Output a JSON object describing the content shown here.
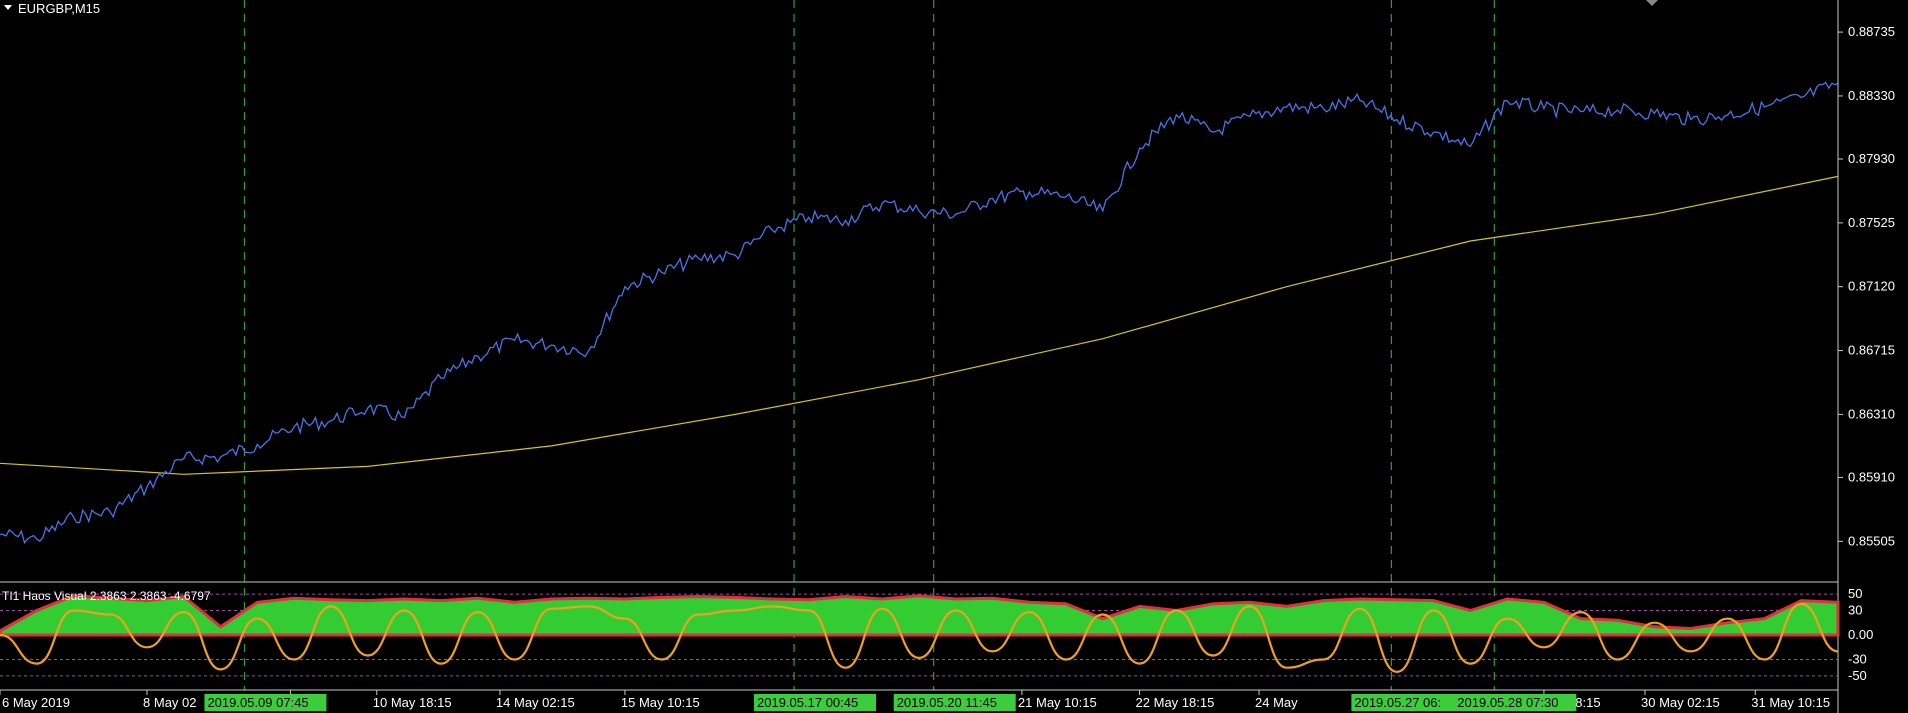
{
  "window": {
    "title": "EURGBP,M15"
  },
  "indicator": {
    "name": "TI1 Haos Visual 2.3863 2.3863 -4.6797",
    "levels": [
      "50",
      "30",
      "0.00",
      "-30",
      "-50"
    ]
  },
  "chart_data": {
    "type": "line",
    "symbol": "EURGBP",
    "timeframe": "M15",
    "price_axis": {
      "ticks": [
        "0.88735",
        "0.88330",
        "0.87930",
        "0.87525",
        "0.87120",
        "0.86715",
        "0.86310",
        "0.85910",
        "0.85505"
      ],
      "ylim": [
        0.8545,
        0.8878
      ]
    },
    "time_axis": {
      "ticks": [
        "6 May 2019",
        "8 May 02",
        "0:15",
        "10 May 18:15",
        "14 May 02:15",
        "15 May 10:15",
        "21 May 10:15",
        "22 May 18:15",
        "24 May",
        "May 18:15",
        "30 May 02:15",
        "31 May 10:15"
      ],
      "highlighted": [
        "2019.05.09 07:45",
        "2019.05.17 00:45",
        "2019.05.20 11:45",
        "2019.05.27 06:",
        "2019.05.28 07:30"
      ]
    },
    "series": [
      {
        "role": "price",
        "color": "#4a73e8",
        "x": [
          0,
          2,
          4,
          6,
          8,
          10,
          12,
          14,
          16,
          18,
          20,
          22,
          24,
          26,
          28,
          30,
          32,
          34,
          36,
          38,
          40,
          42,
          44,
          46,
          48,
          50,
          52,
          54,
          56,
          58,
          60,
          62,
          64,
          66,
          68,
          70,
          72,
          74,
          76,
          78,
          80,
          82,
          84,
          86,
          88,
          90,
          92,
          94,
          96,
          98,
          100
        ],
        "y": [
          0.8555,
          0.8552,
          0.8566,
          0.8569,
          0.8585,
          0.8603,
          0.8604,
          0.8612,
          0.8623,
          0.8627,
          0.8635,
          0.8629,
          0.8654,
          0.8668,
          0.8678,
          0.8675,
          0.8671,
          0.8712,
          0.8721,
          0.873,
          0.8732,
          0.8748,
          0.8756,
          0.8754,
          0.8765,
          0.876,
          0.8758,
          0.8768,
          0.8772,
          0.8769,
          0.876,
          0.88,
          0.8821,
          0.881,
          0.882,
          0.8826,
          0.8825,
          0.883,
          0.8818,
          0.881,
          0.8801,
          0.883,
          0.8825,
          0.8823,
          0.8824,
          0.8822,
          0.8818,
          0.8821,
          0.8826,
          0.8832,
          0.8841
        ]
      },
      {
        "role": "moving_average",
        "color": "#d4c42a",
        "x": [
          0,
          10,
          20,
          30,
          40,
          50,
          60,
          70,
          80,
          90,
          100
        ],
        "y": [
          0.86,
          0.8593,
          0.8598,
          0.8611,
          0.8631,
          0.8653,
          0.8679,
          0.8712,
          0.8741,
          0.8758,
          0.8782
        ]
      }
    ],
    "vlines_x": [
      13.3,
      43.2,
      50.8,
      75.7,
      81.3
    ],
    "indicator_data": {
      "ylim": [
        -55,
        55
      ],
      "x": [
        0,
        2,
        4,
        6,
        8,
        10,
        12,
        14,
        16,
        18,
        20,
        22,
        24,
        26,
        28,
        30,
        32,
        34,
        36,
        38,
        40,
        42,
        44,
        46,
        48,
        50,
        52,
        54,
        56,
        58,
        60,
        62,
        64,
        66,
        68,
        70,
        72,
        74,
        76,
        78,
        80,
        82,
        84,
        86,
        88,
        90,
        92,
        94,
        96,
        98,
        100
      ],
      "area": [
        5,
        30,
        48,
        45,
        42,
        47,
        10,
        40,
        45,
        43,
        42,
        44,
        42,
        45,
        40,
        44,
        45,
        44,
        46,
        47,
        46,
        44,
        43,
        47,
        44,
        48,
        44,
        45,
        40,
        38,
        20,
        35,
        30,
        38,
        40,
        35,
        42,
        44,
        43,
        42,
        30,
        44,
        40,
        20,
        18,
        10,
        8,
        15,
        20,
        42,
        40
      ],
      "line": [
        0,
        -35,
        30,
        25,
        -15,
        28,
        -42,
        20,
        -30,
        35,
        -25,
        30,
        -35,
        28,
        -30,
        32,
        35,
        20,
        -30,
        25,
        30,
        35,
        30,
        -40,
        32,
        -28,
        30,
        -20,
        28,
        -30,
        25,
        -35,
        30,
        -25,
        35,
        -40,
        -30,
        32,
        -45,
        30,
        -35,
        20,
        -15,
        28,
        -30,
        15,
        -20,
        20,
        -30,
        38,
        -20
      ]
    }
  }
}
